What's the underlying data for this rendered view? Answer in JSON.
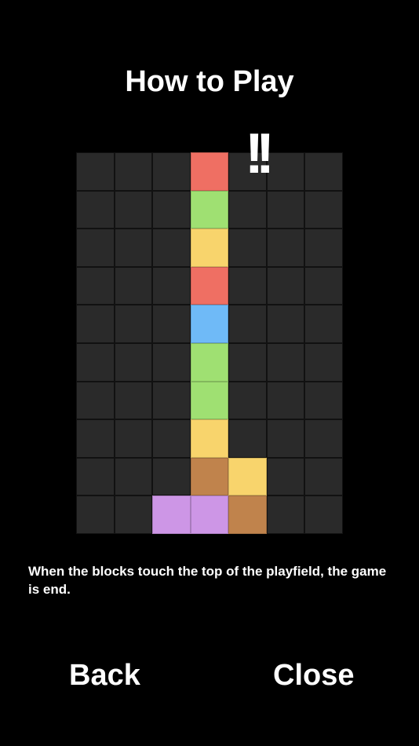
{
  "title": "How to Play",
  "alert_mark": "!!",
  "description": "When the blocks touch the top of the playfield, the game is end.",
  "buttons": {
    "back": "Back",
    "close": "Close"
  },
  "board": {
    "columns": 7,
    "rows": 10,
    "empty_color": "#2a2a2a",
    "colors": {
      "red": "#ef6f63",
      "green": "#9fe072",
      "yellow": "#f8d46c",
      "blue": "#6fbaf7",
      "brown": "#c0834c",
      "purple": "#cd96e6"
    },
    "grid": [
      [
        null,
        null,
        null,
        "red",
        null,
        null,
        null
      ],
      [
        null,
        null,
        null,
        "green",
        null,
        null,
        null
      ],
      [
        null,
        null,
        null,
        "yellow",
        null,
        null,
        null
      ],
      [
        null,
        null,
        null,
        "red",
        null,
        null,
        null
      ],
      [
        null,
        null,
        null,
        "blue",
        null,
        null,
        null
      ],
      [
        null,
        null,
        null,
        "green",
        null,
        null,
        null
      ],
      [
        null,
        null,
        null,
        "green",
        null,
        null,
        null
      ],
      [
        null,
        null,
        null,
        "yellow",
        null,
        null,
        null
      ],
      [
        null,
        null,
        null,
        "brown",
        "yellow",
        null,
        null
      ],
      [
        null,
        null,
        "purple",
        "purple",
        "brown",
        null,
        null
      ]
    ]
  }
}
